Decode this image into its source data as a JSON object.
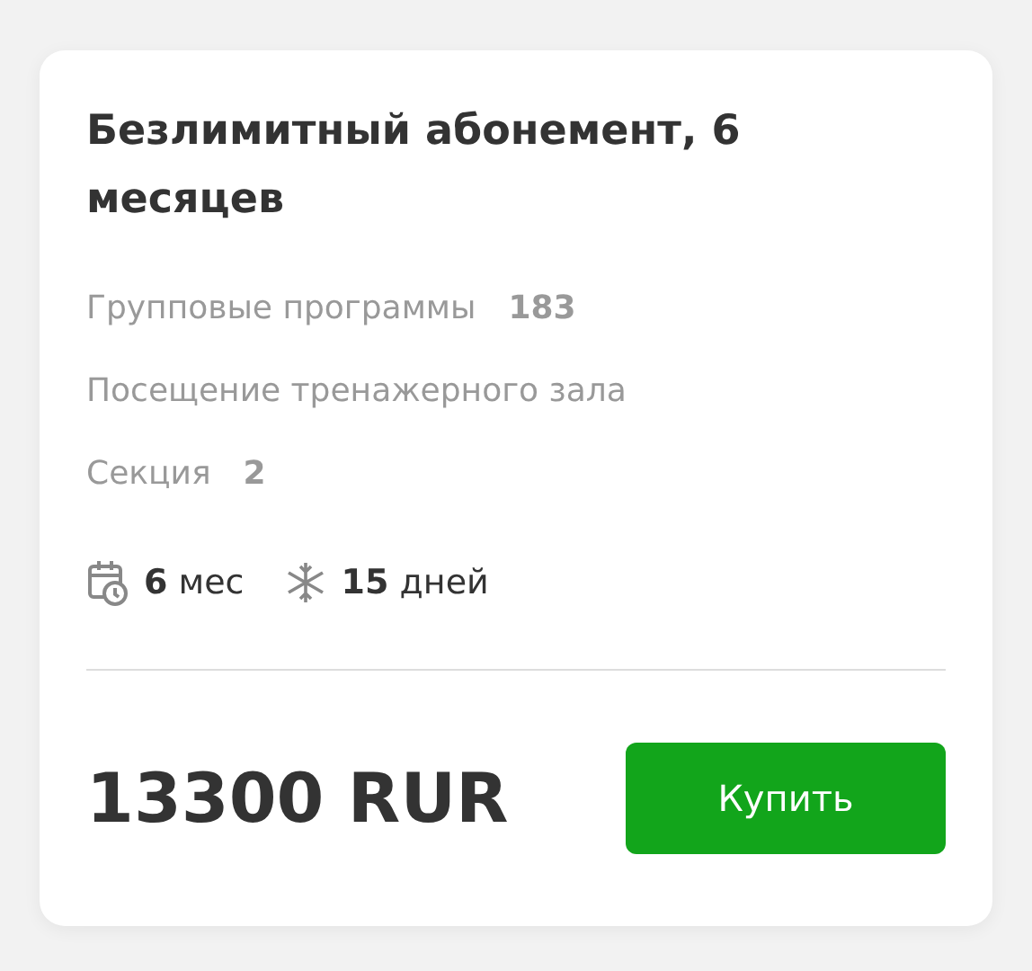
{
  "card": {
    "title": "Безлимитный абонемент, 6 месяцев",
    "features": [
      {
        "label": "Групповые программы",
        "count": "183"
      },
      {
        "label": "Посещение тренажерного зала"
      },
      {
        "label": "Секция",
        "count": "2"
      }
    ],
    "terms": [
      {
        "kind": "duration",
        "value": "6",
        "unit": "мес"
      },
      {
        "kind": "freeze",
        "value": "15",
        "unit": "дней"
      }
    ],
    "price": "13300 RUR",
    "buy_button": "Купить"
  }
}
